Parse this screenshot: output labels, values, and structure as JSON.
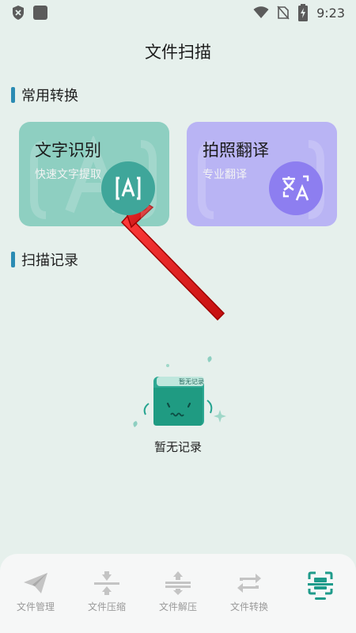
{
  "status_bar": {
    "time": "9:23"
  },
  "page": {
    "title": "文件扫描"
  },
  "sections": {
    "common": "常用转换",
    "records": "扫描记录"
  },
  "cards": [
    {
      "title": "文字识别",
      "subtitle": "快速文字提取",
      "icon": "text-scan-icon"
    },
    {
      "title": "拍照翻译",
      "subtitle": "专业翻译",
      "icon": "translate-icon"
    }
  ],
  "empty": {
    "illustration_label": "暂无记录",
    "text": "暂无记录"
  },
  "bottom_nav": [
    {
      "label": "文件管理",
      "icon": "paper-plane-icon",
      "active": false
    },
    {
      "label": "文件压缩",
      "icon": "compress-icon",
      "active": false
    },
    {
      "label": "文件解压",
      "icon": "decompress-icon",
      "active": false
    },
    {
      "label": "文件转换",
      "icon": "convert-icon",
      "active": false
    },
    {
      "label": "",
      "icon": "scan-icon",
      "active": true
    }
  ],
  "colors": {
    "background": "#e6f0ec",
    "ocr_card": "#8ecfc1",
    "translate_card": "#b9b4f4",
    "accent": "#1f9b8b",
    "arrow": "#e41e1e"
  }
}
